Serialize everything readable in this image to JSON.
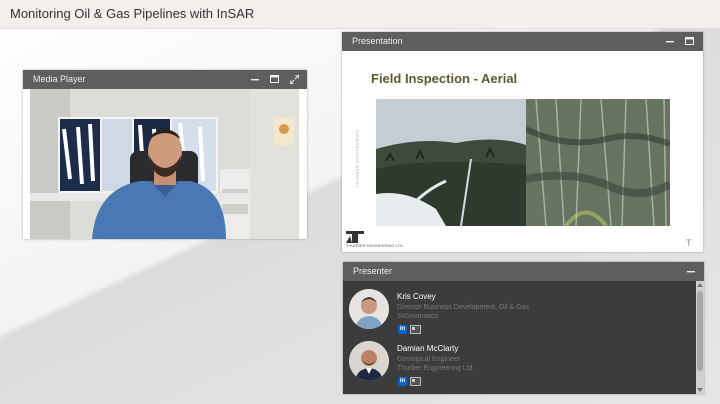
{
  "window": {
    "title": "Monitoring Oil & Gas Pipelines with InSAR"
  },
  "media_player": {
    "title": "Media Player",
    "controls": [
      "minimize-icon",
      "maximize-icon",
      "expand-icon"
    ]
  },
  "presentation": {
    "title": "Presentation",
    "controls": [
      "minimize-icon",
      "maximize-icon"
    ],
    "slide": {
      "title": "Field Inspection - Aerial",
      "logo_text": "THURBER ENGINEERING LTD.",
      "side_text": "THURBER ENGINEERING",
      "corner_mark": "T"
    }
  },
  "presenter": {
    "title": "Presenter",
    "controls": [
      "minimize-icon"
    ],
    "people": [
      {
        "name": "Kris Covey",
        "role": "Director Business Development, Oil & Gas",
        "org": "3vGeomatics",
        "icons": [
          "linkedin-icon",
          "contact-card-icon"
        ]
      },
      {
        "name": "Damian McClarty",
        "role": "Geological Engineer",
        "org": "Thurber Engineering Ltd.",
        "icons": [
          "linkedin-icon",
          "contact-card-icon"
        ]
      }
    ]
  },
  "colors": {
    "header": "#5e5e5e",
    "slide_title": "#5d5a2f",
    "topbar": "#f4eeec",
    "linkedin": "#0a66c2"
  }
}
